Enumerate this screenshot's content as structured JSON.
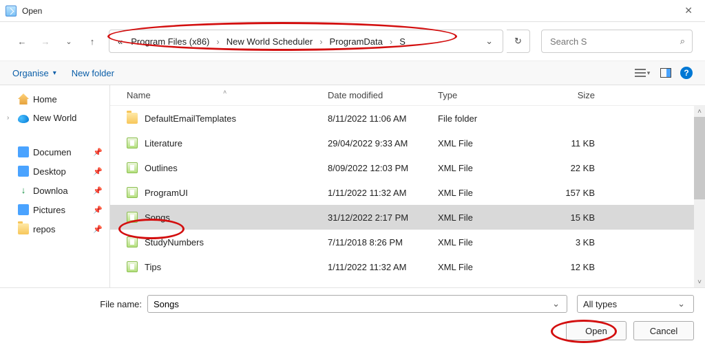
{
  "window": {
    "title": "Open"
  },
  "breadcrumb": {
    "overflow": "«",
    "items": [
      "Program Files (x86)",
      "New World Scheduler",
      "ProgramData",
      "S"
    ]
  },
  "search": {
    "placeholder": "Search S"
  },
  "toolbar": {
    "organise": "Organise",
    "newfolder": "New folder",
    "help": "?"
  },
  "tree": {
    "home": "Home",
    "onedrive": "New World",
    "quick": [
      {
        "label": "Documen",
        "icon": "blue"
      },
      {
        "label": "Desktop",
        "icon": "blue"
      },
      {
        "label": "Downloa",
        "icon": "down"
      },
      {
        "label": "Pictures",
        "icon": "blue"
      },
      {
        "label": "repos",
        "icon": "folder"
      }
    ]
  },
  "columns": {
    "name": "Name",
    "date": "Date modified",
    "type": "Type",
    "size": "Size"
  },
  "files": [
    {
      "name": "DefaultEmailTemplates",
      "date": "8/11/2022 11:06 AM",
      "type": "File folder",
      "size": "",
      "kind": "folder",
      "selected": false
    },
    {
      "name": "Literature",
      "date": "29/04/2022 9:33 AM",
      "type": "XML File",
      "size": "11 KB",
      "kind": "xml",
      "selected": false
    },
    {
      "name": "Outlines",
      "date": "8/09/2022 12:03 PM",
      "type": "XML File",
      "size": "22 KB",
      "kind": "xml",
      "selected": false
    },
    {
      "name": "ProgramUI",
      "date": "1/11/2022 11:32 AM",
      "type": "XML File",
      "size": "157 KB",
      "kind": "xml",
      "selected": false
    },
    {
      "name": "Songs",
      "date": "31/12/2022 2:17 PM",
      "type": "XML File",
      "size": "15 KB",
      "kind": "xml",
      "selected": true
    },
    {
      "name": "StudyNumbers",
      "date": "7/11/2018 8:26 PM",
      "type": "XML File",
      "size": "3 KB",
      "kind": "xml",
      "selected": false
    },
    {
      "name": "Tips",
      "date": "1/11/2022 11:32 AM",
      "type": "XML File",
      "size": "12 KB",
      "kind": "xml",
      "selected": false
    }
  ],
  "filename": {
    "label": "File name:",
    "value": "Songs"
  },
  "filter": {
    "value": "All types"
  },
  "buttons": {
    "open": "Open",
    "cancel": "Cancel"
  }
}
